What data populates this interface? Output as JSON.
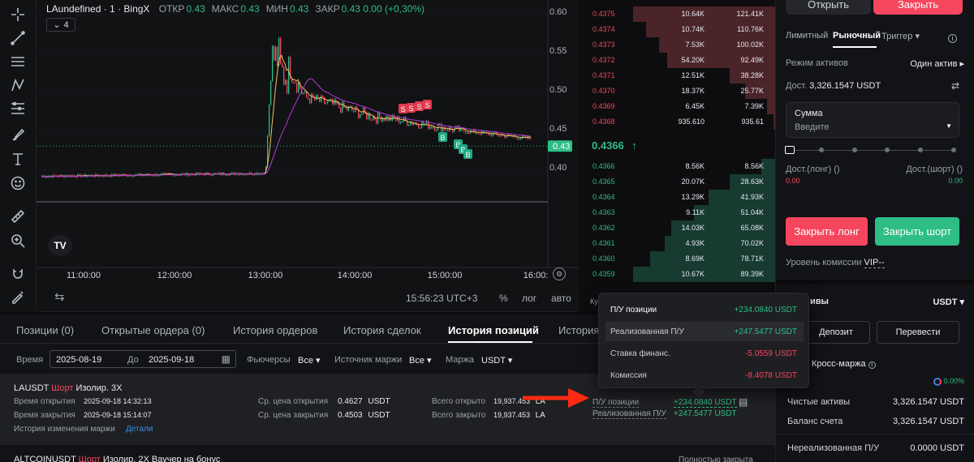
{
  "chart": {
    "title": "LAundefined · 1 · BingX",
    "ohlc": [
      {
        "k": "ОТКР",
        "v": "0.43"
      },
      {
        "k": "МАКС",
        "v": "0.43"
      },
      {
        "k": "МИН",
        "v": "0.43"
      },
      {
        "k": "ЗАКР",
        "v": "0.43"
      }
    ],
    "change": "0.00 (+0,30%)",
    "indicator_count": "4",
    "y_ticks": [
      "0.60",
      "0.55",
      "0.50",
      "0.45",
      "0.40"
    ],
    "price_tag": "0.43",
    "x_ticks": [
      "11:00:00",
      "12:00:00",
      "13:00:00",
      "14:00:00",
      "15:00:00",
      "16:00:"
    ],
    "clock": "15:56:23 UTC+3",
    "pct": "%",
    "log": "лог",
    "auto": "авто",
    "sell_markers": [
      "S",
      "S",
      "S",
      "S"
    ],
    "buy_markers": [
      "B",
      "B",
      "B",
      "B"
    ]
  },
  "orderbook": {
    "asks": [
      {
        "p": "0.4375",
        "s": "10.64K",
        "t": "121.41K",
        "d": 1.0
      },
      {
        "p": "0.4374",
        "s": "10.74K",
        "t": "110.76K",
        "d": 0.91
      },
      {
        "p": "0.4373",
        "s": "7.53K",
        "t": "100.02K",
        "d": 0.82
      },
      {
        "p": "0.4372",
        "s": "54.20K",
        "t": "92.49K",
        "d": 0.76
      },
      {
        "p": "0.4371",
        "s": "12.51K",
        "t": "38.28K",
        "d": 0.32
      },
      {
        "p": "0.4370",
        "s": "18.37K",
        "t": "25.77K",
        "d": 0.21
      },
      {
        "p": "0.4369",
        "s": "6.45K",
        "t": "7.39K",
        "d": 0.06
      },
      {
        "p": "0.4368",
        "s": "935.610",
        "t": "935.61",
        "d": 0.01
      }
    ],
    "mid": "0.4366",
    "mid_arrow": "↑",
    "bids": [
      {
        "p": "0.4366",
        "s": "8.56K",
        "t": "8.56K",
        "d": 0.1
      },
      {
        "p": "0.4365",
        "s": "20.07K",
        "t": "28.63K",
        "d": 0.32
      },
      {
        "p": "0.4364",
        "s": "13.29K",
        "t": "41.93K",
        "d": 0.47
      },
      {
        "p": "0.4363",
        "s": "9.11K",
        "t": "51.04K",
        "d": 0.57
      },
      {
        "p": "0.4362",
        "s": "14.03K",
        "t": "65.08K",
        "d": 0.73
      },
      {
        "p": "0.4361",
        "s": "4.93K",
        "t": "70.02K",
        "d": 0.78
      },
      {
        "p": "0.4360",
        "s": "8.69K",
        "t": "78.71K",
        "d": 0.88
      },
      {
        "p": "0.4359",
        "s": "10.67K",
        "t": "89.39K",
        "d": 1.0
      }
    ],
    "bottom_cut": "Ку"
  },
  "right": {
    "open_tab": "Открыть",
    "close_tab": "Закрыть",
    "order_types": [
      "Лимитный",
      "Рыночный",
      "Триггер ▾"
    ],
    "asset_mode_label": "Режим активов",
    "asset_mode_value": "Один актив ▸",
    "avail_label": "Дост.",
    "avail_value": "3,326.1547 USDT",
    "amount_label": "Сумма",
    "amount_placeholder": "Введите",
    "avail_long_label": "Дост.(лонг) ()",
    "avail_short_label": "Дост.(шорт) ()",
    "avail_long_value": "0.00",
    "avail_short_value": "0.00",
    "close_long": "Закрыть лонг",
    "close_short": "Закрыть шорт",
    "fee_label": "Уровень комиссии",
    "fee_value": "VIP--",
    "assets_title": "ивы",
    "currency": "USDT ▾",
    "deposit": "Депозит",
    "transfer": "Перевести",
    "cross_label": "Кросс-маржа",
    "ratio": "0.00%",
    "net_label": "Чистые активы",
    "net_value": "3,326.1547 USDT",
    "balance_label": "Баланс счета",
    "balance_value": "3,326.1547 USDT",
    "unreal_label": "Нереализованная П/У",
    "unreal_value": "0.0000 USDT"
  },
  "bottom": {
    "tabs": [
      "Позиции (0)",
      "Открытые ордера (0)",
      "История ордеров",
      "История сделок",
      "История позиций",
      "История"
    ],
    "time_label": "Время",
    "date_from": "2025-08-19",
    "date_to_label": "До",
    "date_to": "2025-09-18",
    "futures_label": "Фьючерсы",
    "futures_value": "Все ▾",
    "source_label": "Источник маржи",
    "source_value": "Все ▾",
    "margin_label": "Маржа",
    "margin_value": "USDT ▾",
    "row1": {
      "symbol": "LAUSDT",
      "side": "Шорт",
      "mode": "Изолир.",
      "lev": "3X",
      "open_time_label": "Время открытия",
      "open_time": "2025-09-18 14:32:13",
      "close_time_label": "Время закрытия",
      "close_time": "2025-09-18 15:14:07",
      "hist_label": "История изменения маржи",
      "details": "Детали",
      "avg_open_label": "Ср. цена открытия",
      "avg_open": "0.4627",
      "avg_open_cur": "USDT",
      "avg_close_label": "Ср. цена закрытия",
      "avg_close": "0.4503",
      "avg_close_cur": "USDT",
      "total_open_label": "Всего открыто",
      "total_open": "19,937.453",
      "total_open_cur": "LA",
      "total_close_label": "Всего закрыто",
      "total_close": "19,937.453",
      "total_close_cur": "LA",
      "pnl_label": "П/У позиции",
      "pnl": "+234.0840 USDT",
      "realized_label": "Реализованная П/У",
      "realized": "+247.5477 USDT"
    },
    "row2": {
      "symbol": "ALTCOINUSDT",
      "side": "Шорт",
      "rest": "Изолир.  2X  Ваучер на бонус",
      "close_all": "Полностью закрыта"
    }
  },
  "tooltip": {
    "rows": [
      {
        "l": "П/У позиции",
        "v": "+234.0840 USDT",
        "c": "#2ebd85"
      },
      {
        "l": "Реализованная П/У",
        "v": "+247.5477 USDT",
        "c": "#2ebd85"
      },
      {
        "l": "Ставка финанс.",
        "v": "-5.0559 USDT",
        "c": "#f6465d"
      },
      {
        "l": "Комиссия",
        "v": "-8.4078 USDT",
        "c": "#f6465d"
      }
    ]
  }
}
